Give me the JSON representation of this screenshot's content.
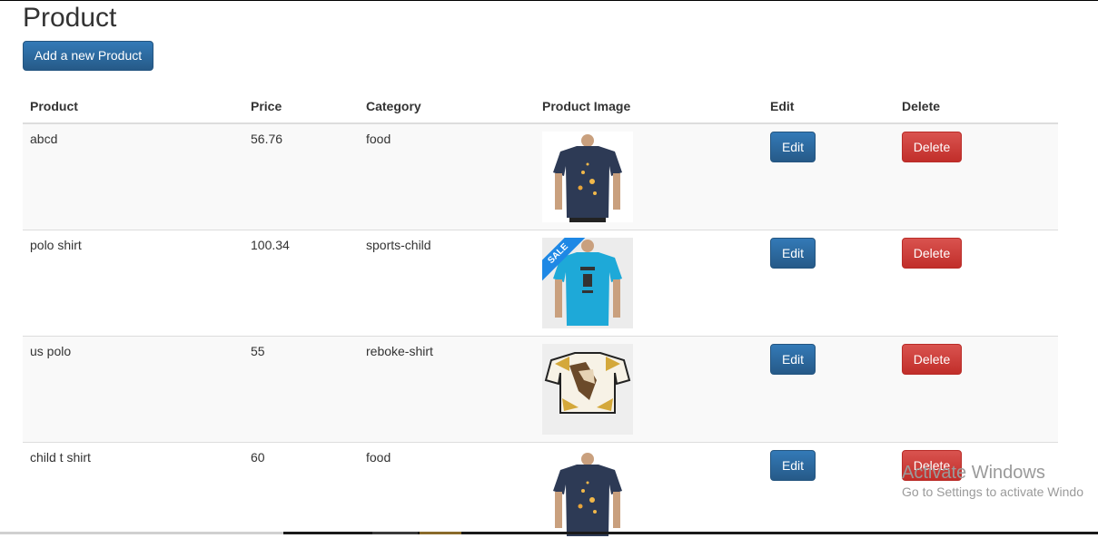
{
  "page": {
    "title": "Product",
    "add_button": "Add a new Product"
  },
  "table": {
    "headers": {
      "product": "Product",
      "price": "Price",
      "category": "Category",
      "image": "Product Image",
      "edit": "Edit",
      "delete": "Delete"
    },
    "rows": [
      {
        "product": "abcd",
        "price": "56.76",
        "category": "food",
        "image": "navy-tshirt",
        "edit": "Edit",
        "delete": "Delete"
      },
      {
        "product": "polo shirt",
        "price": "100.34",
        "category": "sports-child",
        "image": "blue-tshirt-sale",
        "sale_label": "SALE",
        "edit": "Edit",
        "delete": "Delete"
      },
      {
        "product": "us polo",
        "price": "55",
        "category": "reboke-shirt",
        "image": "printed-tshirt",
        "edit": "Edit",
        "delete": "Delete"
      },
      {
        "product": "child t shirt",
        "price": "60",
        "category": "food",
        "image": "navy-tshirt",
        "edit": "Edit",
        "delete": "Delete"
      }
    ]
  },
  "watermark": {
    "line1": "Activate Windows",
    "line2": "Go to Settings to activate Windo"
  },
  "colors": {
    "primary": "#337ab7",
    "danger": "#d9534f",
    "row_stripe": "#f9f9f9"
  }
}
